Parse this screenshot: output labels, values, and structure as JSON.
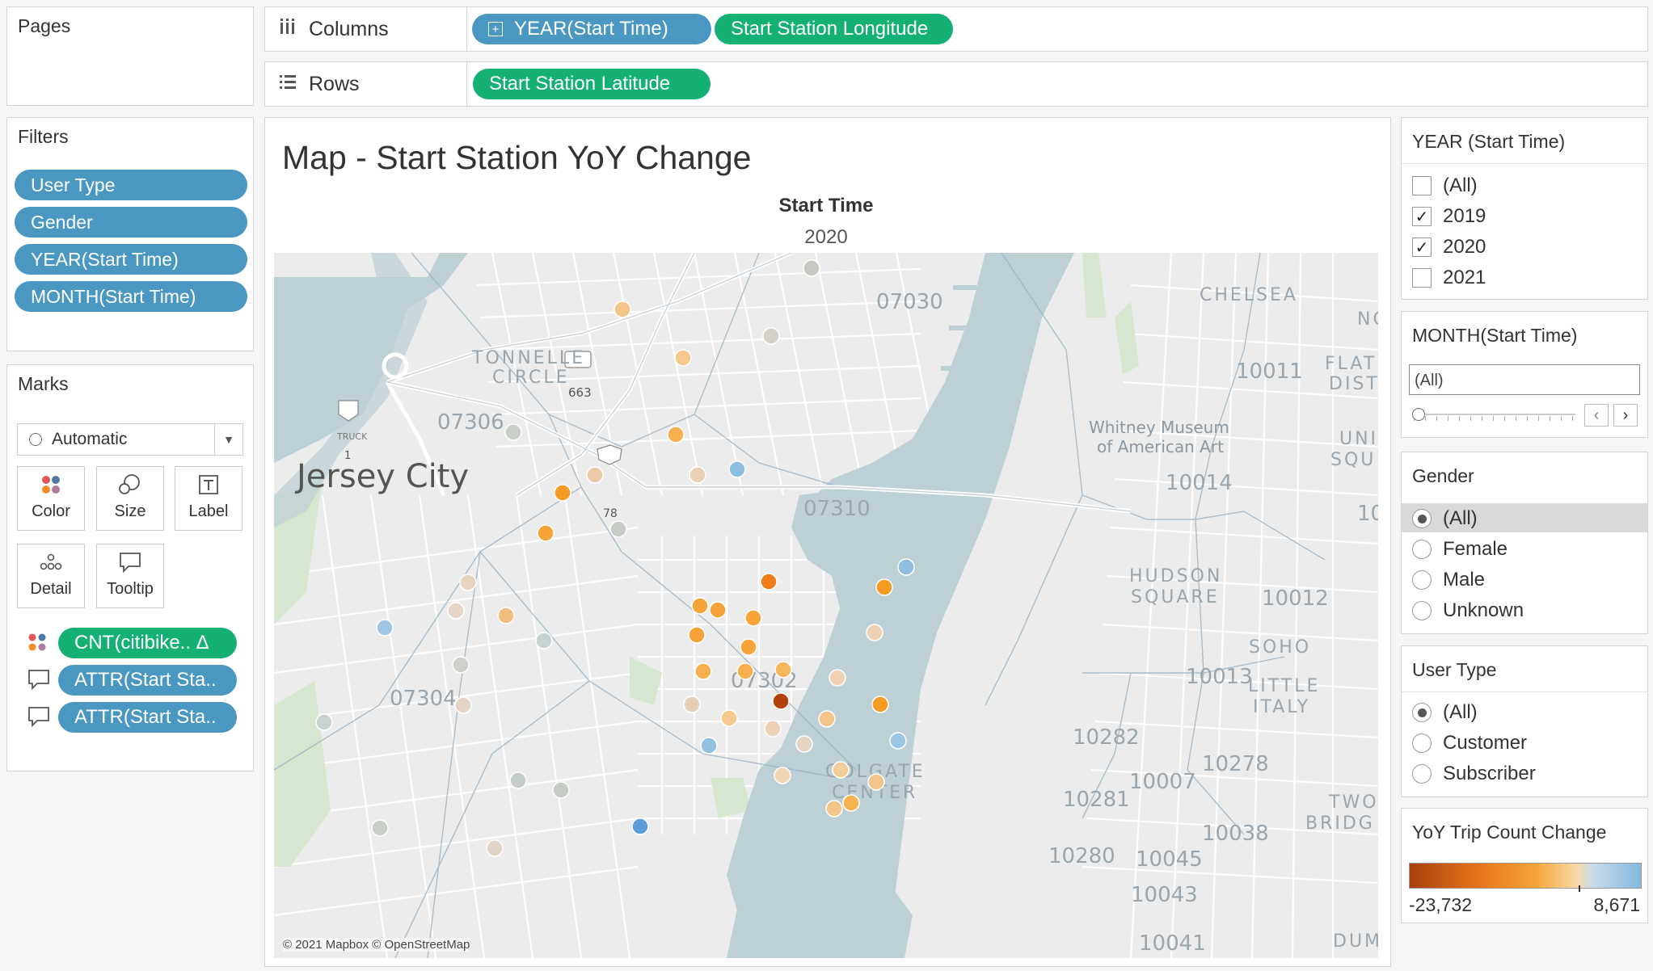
{
  "shelves": {
    "pages_label": "Pages",
    "columns_label": "Columns",
    "rows_label": "Rows",
    "columns_pills": [
      "YEAR(Start Time)",
      "Start Station Longitude"
    ],
    "rows_pills": [
      "Start Station Latitude"
    ]
  },
  "filters": {
    "title": "Filters",
    "items": [
      "User Type",
      "Gender",
      "YEAR(Start Time)",
      "MONTH(Start Time)"
    ]
  },
  "marks": {
    "title": "Marks",
    "mark_type": "Automatic",
    "buttons": {
      "color": "Color",
      "size": "Size",
      "label": "Label",
      "detail": "Detail",
      "tooltip": "Tooltip"
    },
    "fields": [
      "CNT(citibike.. Δ",
      "ATTR(Start Sta..",
      "ATTR(Start Sta.."
    ]
  },
  "view": {
    "title": "Map - Start Station YoY Change",
    "column_header": "Start Time",
    "column_value": "2020",
    "attribution": "© 2021 Mapbox © OpenStreetMap"
  },
  "map_labels": {
    "jersey_city": "Jersey City",
    "tonnelle_1": "TONNELLE",
    "tonnelle_2": "CIRCLE",
    "z07030": "07030",
    "z07306": "07306",
    "z07310": "07310",
    "z07302": "07302",
    "z07304": "07304",
    "chelsea": "CHELSEA",
    "z10011": "10011",
    "flat_1": "FLAT",
    "flat_2": "DIST",
    "nc": "NC",
    "whitney_1": "Whitney Museum",
    "whitney_2": "of American Art",
    "z10014": "10014",
    "uni_1": "UNI",
    "uni_2": "SQU",
    "z10": "10",
    "hudson_1": "HUDSON",
    "hudson_2": "SQUARE",
    "z10012": "10012",
    "soho": "SOHO",
    "z10013": "10013",
    "little_1": "LITTLE",
    "little_2": "ITALY",
    "z10282": "10282",
    "z10278": "10278",
    "z10007": "10007",
    "z10281": "10281",
    "two_1": "TWO",
    "two_2": "BRIDG",
    "z10038": "10038",
    "z10280": "10280",
    "z10045": "10045",
    "z10043": "10043",
    "z10041": "10041",
    "dum": "DUM",
    "colgate_1": "COLGATE",
    "colgate_2": "CENTER",
    "hw663": "663",
    "hw78": "78",
    "hw1": "1",
    "truck": "TRUCK"
  },
  "year_filter": {
    "title": "YEAR (Start Time)",
    "options": [
      {
        "label": "(All)",
        "checked": false
      },
      {
        "label": "2019",
        "checked": true
      },
      {
        "label": "2020",
        "checked": true
      },
      {
        "label": "2021",
        "checked": false
      }
    ]
  },
  "month_filter": {
    "title": "MONTH(Start Time)",
    "value": "(All)"
  },
  "gender_filter": {
    "title": "Gender",
    "options": [
      "(All)",
      "Female",
      "Male",
      "Unknown"
    ],
    "selected": "(All)"
  },
  "user_type_filter": {
    "title": "User Type",
    "options": [
      "(All)",
      "Customer",
      "Subscriber"
    ],
    "selected": "(All)"
  },
  "legend": {
    "title": "YoY Trip Count Change",
    "min": "-23,732",
    "max": "8,671",
    "colors": [
      "#a8400e",
      "#e8741a",
      "#f6a53a",
      "#f9d9a5",
      "#c9dcea",
      "#85b8dc"
    ]
  },
  "colors": {
    "pill_blue": "#4a97c2",
    "pill_green": "#15b074",
    "water": "#bcd0d6",
    "land": "#ececec"
  }
}
